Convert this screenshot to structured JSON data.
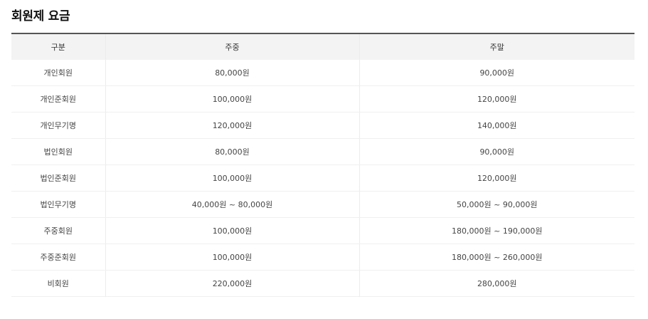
{
  "page": {
    "title": "회원제 요금"
  },
  "table": {
    "headers": [
      "구분",
      "주중",
      "주말"
    ],
    "rows": [
      [
        "개인회원",
        "80,000원",
        "90,000원"
      ],
      [
        "개인준회원",
        "100,000원",
        "120,000원"
      ],
      [
        "개인무기명",
        "120,000원",
        "140,000원"
      ],
      [
        "법인회원",
        "80,000원",
        "90,000원"
      ],
      [
        "법인준회원",
        "100,000원",
        "120,000원"
      ],
      [
        "법인무기명",
        "40,000원 ~ 80,000원",
        "50,000원 ~ 90,000원"
      ],
      [
        "주중회원",
        "100,000원",
        "180,000원 ~ 190,000원"
      ],
      [
        "주중준회원",
        "100,000원",
        "180,000원 ~ 260,000원"
      ],
      [
        "비회원",
        "220,000원",
        "280,000원"
      ]
    ]
  },
  "colors": {
    "header_bg": "#f3f3f3",
    "header_border": "#555555",
    "row_border": "#f0f0f0"
  }
}
